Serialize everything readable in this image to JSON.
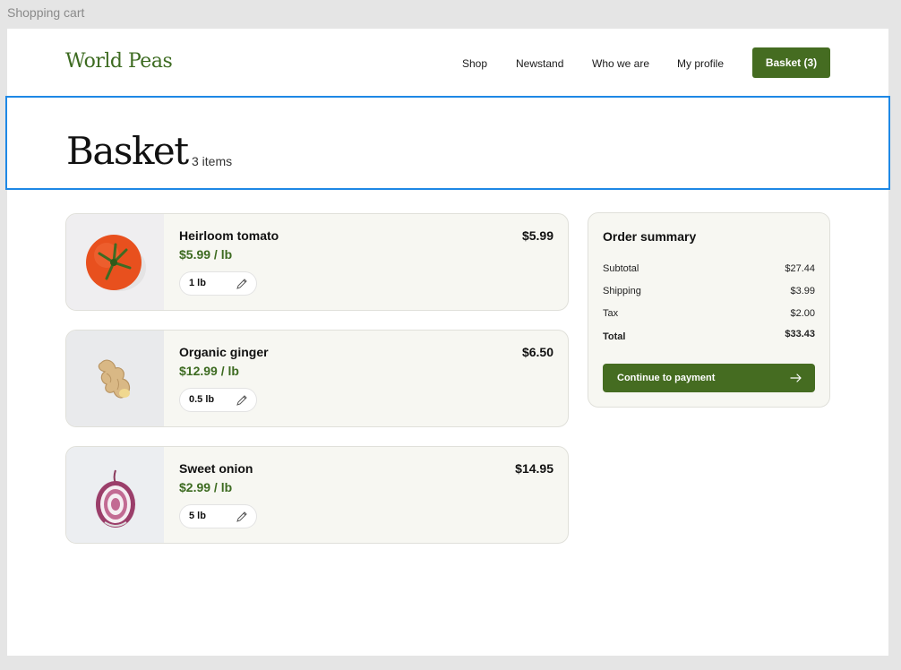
{
  "frame": {
    "label": "Shopping cart"
  },
  "header": {
    "logo": "World Peas",
    "nav": [
      "Shop",
      "Newstand",
      "Who we are",
      "My profile"
    ],
    "basket_button": "Basket (3)"
  },
  "page": {
    "title": "Basket",
    "item_count": "3 items"
  },
  "items": [
    {
      "name": "Heirloom tomato",
      "unit_price": "$5.99 / lb",
      "price": "$5.99",
      "quantity": "1 lb",
      "image": "tomato"
    },
    {
      "name": "Organic ginger",
      "unit_price": "$12.99 / lb",
      "price": "$6.50",
      "quantity": "0.5 lb",
      "image": "ginger"
    },
    {
      "name": "Sweet onion",
      "unit_price": "$2.99 / lb",
      "price": "$14.95",
      "quantity": "5 lb",
      "image": "onion"
    }
  ],
  "summary": {
    "title": "Order summary",
    "rows": [
      {
        "label": "Subtotal",
        "value": "$27.44"
      },
      {
        "label": "Shipping",
        "value": "$3.99"
      },
      {
        "label": "Tax",
        "value": "$2.00"
      },
      {
        "label": "Total",
        "value": "$33.43"
      }
    ],
    "button": "Continue to payment"
  },
  "icons": {
    "edit": "pencil-icon",
    "arrow": "arrow-right-icon"
  },
  "colors": {
    "brand_green": "#456c21",
    "accent_text_green": "#3d6b21",
    "card_bg": "#f7f7f2",
    "selection_outline": "#1e88e5"
  }
}
